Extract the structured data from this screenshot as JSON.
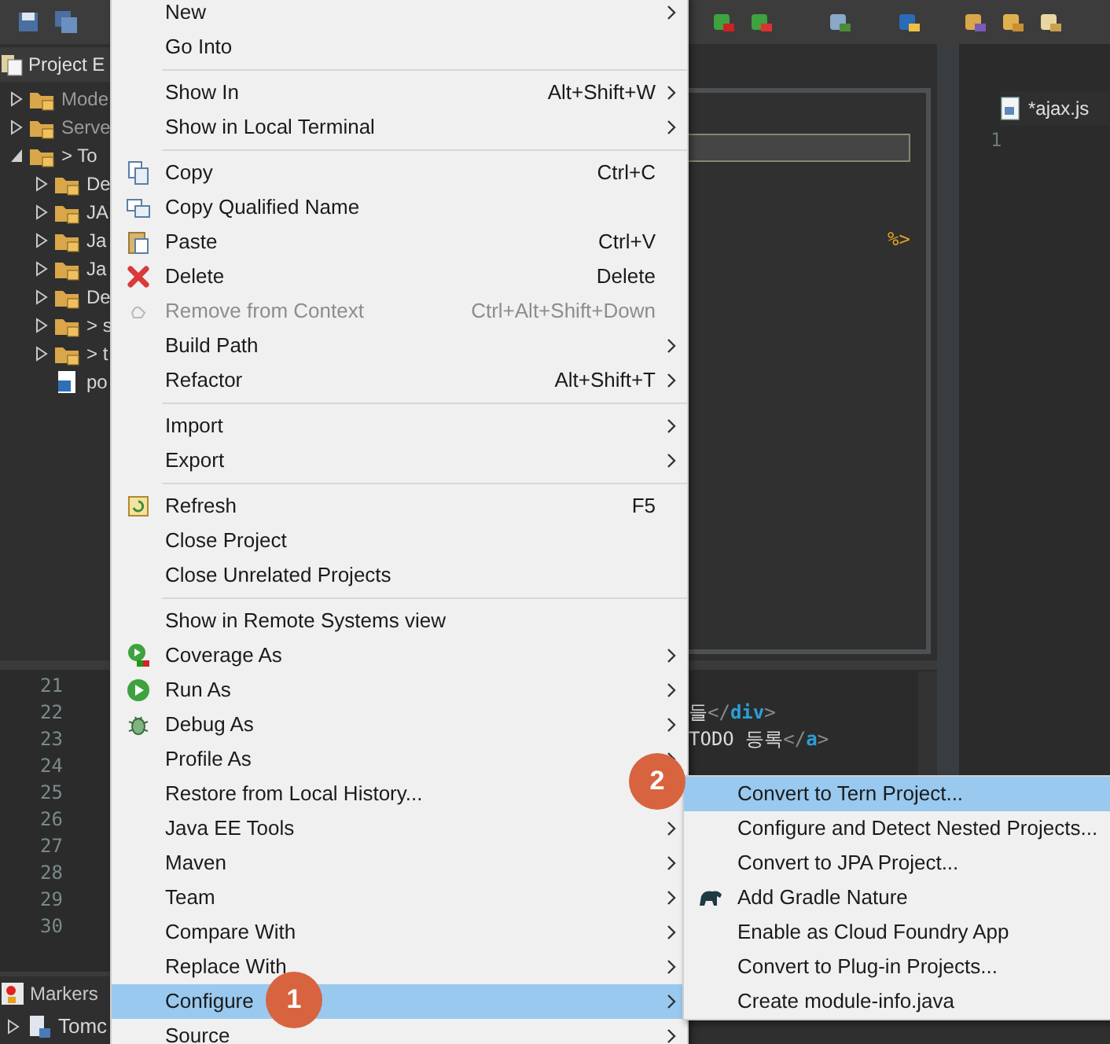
{
  "explorer": {
    "title": "Project E",
    "tree": [
      {
        "label": "Mode",
        "kind": "folder",
        "expanded": false
      },
      {
        "label": "Serve",
        "kind": "folder",
        "expanded": false
      },
      {
        "label": "> To",
        "kind": "folder",
        "expanded": true,
        "children": [
          {
            "label": "De",
            "kind": "folder",
            "expanded": false
          },
          {
            "label": "JA",
            "kind": "folder",
            "expanded": false
          },
          {
            "label": "Ja",
            "kind": "folder",
            "expanded": false
          },
          {
            "label": "Ja",
            "kind": "folder",
            "expanded": false
          },
          {
            "label": "De",
            "kind": "folder",
            "expanded": false
          },
          {
            "label": "> s",
            "kind": "folder",
            "expanded": false
          },
          {
            "label": "> t",
            "kind": "folder",
            "expanded": false
          },
          {
            "label": "po",
            "kind": "file"
          }
        ]
      }
    ]
  },
  "editor": {
    "fragment": "%>",
    "line_numbers": [
      "21",
      "22",
      "23",
      "24",
      "25",
      "26",
      "27",
      "28",
      "29",
      "30"
    ],
    "code_lines": [
      {
        "parts": [
          {
            "kind": "text",
            "text": "들"
          },
          {
            "kind": "bracket",
            "text": "</"
          },
          {
            "kind": "tag",
            "text": "div"
          },
          {
            "kind": "bracket",
            "text": ">"
          }
        ]
      },
      {
        "parts": [
          {
            "kind": "text",
            "text": "TODO 등록"
          },
          {
            "kind": "bracket",
            "text": "</"
          },
          {
            "kind": "tag",
            "text": "a"
          },
          {
            "kind": "bracket",
            "text": ">"
          }
        ]
      }
    ]
  },
  "side_editor": {
    "tab": "*ajax.js",
    "line_numbers": [
      "1"
    ]
  },
  "bottom_panel": {
    "tab": "Markers",
    "rows": [
      {
        "label": "Tomc",
        "expanded": false
      }
    ]
  },
  "context_menu": [
    {
      "kind": "item",
      "label": "New",
      "submenu": true,
      "disabled": false,
      "selected": false
    },
    {
      "kind": "item",
      "label": "Go Into",
      "submenu": false,
      "disabled": false,
      "selected": false
    },
    {
      "kind": "separator"
    },
    {
      "kind": "item",
      "label": "Show In",
      "shortcut": "Alt+Shift+W",
      "submenu": true,
      "disabled": false,
      "selected": false
    },
    {
      "kind": "item",
      "label": "Show in Local Terminal",
      "submenu": true,
      "disabled": false,
      "selected": false
    },
    {
      "kind": "separator"
    },
    {
      "kind": "item",
      "label": "Copy",
      "shortcut": "Ctrl+C",
      "submenu": false,
      "disabled": false,
      "selected": false
    },
    {
      "kind": "item",
      "label": "Copy Qualified Name",
      "submenu": false,
      "disabled": false,
      "selected": false
    },
    {
      "kind": "item",
      "label": "Paste",
      "shortcut": "Ctrl+V",
      "submenu": false,
      "disabled": false,
      "selected": false
    },
    {
      "kind": "item",
      "label": "Delete",
      "shortcut": "Delete",
      "submenu": false,
      "disabled": false,
      "selected": false
    },
    {
      "kind": "item",
      "label": "Remove from Context",
      "shortcut": "Ctrl+Alt+Shift+Down",
      "submenu": false,
      "disabled": true,
      "selected": false
    },
    {
      "kind": "item",
      "label": "Build Path",
      "submenu": true,
      "disabled": false,
      "selected": false
    },
    {
      "kind": "item",
      "label": "Refactor",
      "shortcut": "Alt+Shift+T",
      "submenu": true,
      "disabled": false,
      "selected": false
    },
    {
      "kind": "separator"
    },
    {
      "kind": "item",
      "label": "Import",
      "submenu": true,
      "disabled": false,
      "selected": false
    },
    {
      "kind": "item",
      "label": "Export",
      "submenu": true,
      "disabled": false,
      "selected": false
    },
    {
      "kind": "separator"
    },
    {
      "kind": "item",
      "label": "Refresh",
      "shortcut": "F5",
      "submenu": false,
      "disabled": false,
      "selected": false
    },
    {
      "kind": "item",
      "label": "Close Project",
      "submenu": false,
      "disabled": false,
      "selected": false
    },
    {
      "kind": "item",
      "label": "Close Unrelated Projects",
      "submenu": false,
      "disabled": false,
      "selected": false
    },
    {
      "kind": "separator"
    },
    {
      "kind": "item",
      "label": "Show in Remote Systems view",
      "submenu": false,
      "disabled": false,
      "selected": false
    },
    {
      "kind": "item",
      "label": "Coverage As",
      "submenu": true,
      "disabled": false,
      "selected": false
    },
    {
      "kind": "item",
      "label": "Run As",
      "submenu": true,
      "disabled": false,
      "selected": false
    },
    {
      "kind": "item",
      "label": "Debug As",
      "submenu": true,
      "disabled": false,
      "selected": false
    },
    {
      "kind": "item",
      "label": "Profile As",
      "submenu": true,
      "disabled": false,
      "selected": false
    },
    {
      "kind": "item",
      "label": "Restore from Local History...",
      "disabled": false,
      "selected": false
    },
    {
      "kind": "item",
      "label": "Java EE Tools",
      "submenu": true,
      "disabled": false,
      "selected": false
    },
    {
      "kind": "item",
      "label": "Maven",
      "submenu": true,
      "disabled": false,
      "selected": false
    },
    {
      "kind": "item",
      "label": "Team",
      "submenu": true,
      "disabled": false,
      "selected": false
    },
    {
      "kind": "item",
      "label": "Compare With",
      "submenu": true,
      "disabled": false,
      "selected": false
    },
    {
      "kind": "item",
      "label": "Replace With",
      "submenu": true,
      "disabled": false,
      "selected": false
    },
    {
      "kind": "item",
      "label": "Configure",
      "submenu": true,
      "disabled": false,
      "selected": true
    },
    {
      "kind": "item",
      "label": "Source",
      "submenu": true,
      "disabled": false,
      "selected": false
    }
  ],
  "configure_submenu": [
    {
      "label": "Convert to Tern Project...",
      "selected": true
    },
    {
      "label": "Configure and Detect Nested Projects...",
      "selected": false
    },
    {
      "label": "Convert to JPA Project...",
      "selected": false
    },
    {
      "label": "Add Gradle Nature",
      "selected": false
    },
    {
      "label": "Enable as Cloud Foundry App",
      "selected": false
    },
    {
      "label": "Convert to Plug-in Projects...",
      "selected": false
    },
    {
      "label": "Create module-info.java",
      "selected": false
    }
  ],
  "callouts": [
    {
      "label": "1"
    },
    {
      "label": "2"
    }
  ]
}
